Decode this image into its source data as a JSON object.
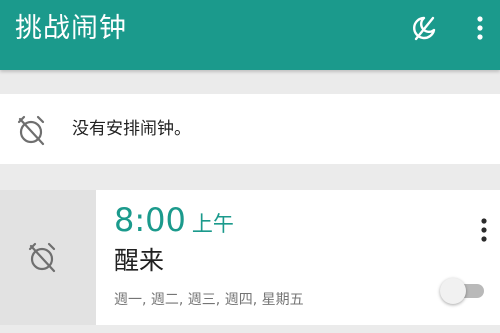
{
  "app_bar": {
    "title": "挑战闹钟",
    "background": "#1b9a8c",
    "actions": [
      {
        "icon": "moon-off-icon"
      },
      {
        "icon": "more-vert-icon"
      }
    ]
  },
  "banner": {
    "icon": "alarm-off-icon",
    "text": "没有安排闹钟。"
  },
  "alarms": [
    {
      "icon": "alarm-off-icon",
      "time": "8:00",
      "ampm": "上午",
      "label": "醒来",
      "days": "週一, 週二, 週三, 週四, 星期五",
      "enabled": false,
      "accent": "#1b9a8c"
    }
  ]
}
